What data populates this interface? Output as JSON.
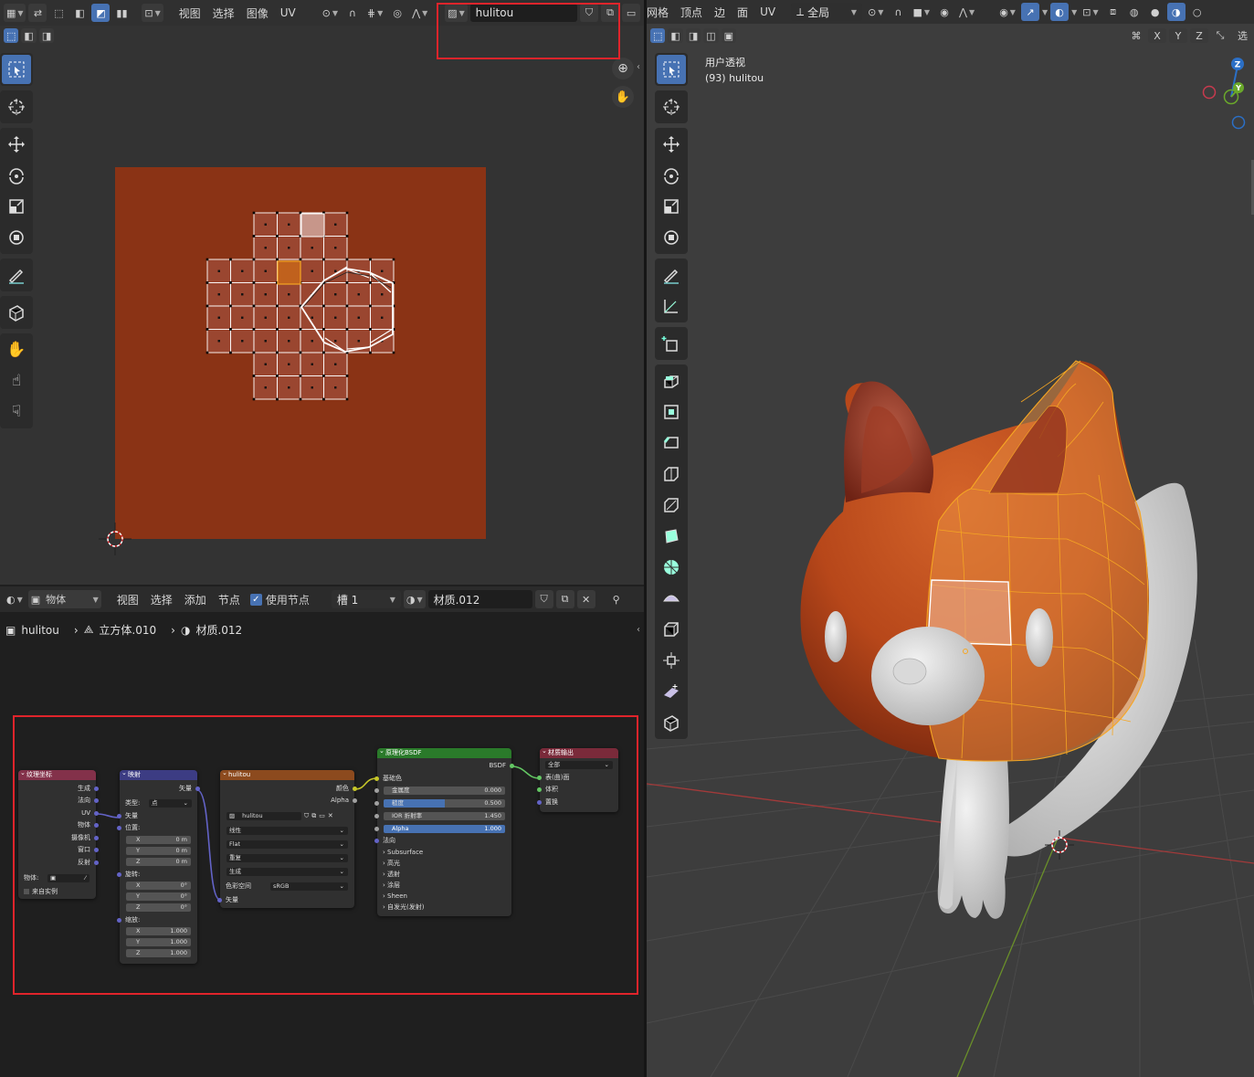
{
  "uv_editor": {
    "header": {
      "menus": [
        "视图",
        "选择",
        "图像",
        "UV"
      ],
      "image_name": "hulitou"
    }
  },
  "node_editor": {
    "header": {
      "mode": "物体",
      "menus": [
        "视图",
        "选择",
        "添加",
        "节点"
      ],
      "use_nodes_label": "使用节点",
      "use_nodes_checked": true,
      "slot": "槽 1",
      "material": "材质.012"
    },
    "breadcrumb": {
      "object": "hulitou",
      "mesh": "立方体.010",
      "material": "材质.012"
    },
    "nodes": {
      "texcoord": {
        "title": "纹理坐标",
        "outputs": [
          "生成",
          "法向",
          "UV",
          "物体",
          "摄像机",
          "窗口",
          "反射"
        ],
        "object_label": "物体:",
        "from_instancer": "来自实例"
      },
      "mapping": {
        "title": "映射",
        "output": "矢量",
        "type_label": "类型:",
        "type_value": "点",
        "vector_label": "矢量",
        "location_label": "位置:",
        "location": [
          [
            "X",
            "0 m"
          ],
          [
            "Y",
            "0 m"
          ],
          [
            "Z",
            "0 m"
          ]
        ],
        "rotation_label": "旋转:",
        "rotation": [
          [
            "X",
            "0°"
          ],
          [
            "Y",
            "0°"
          ],
          [
            "Z",
            "0°"
          ]
        ],
        "scale_label": "缩放:",
        "scale": [
          [
            "X",
            "1.000"
          ],
          [
            "Y",
            "1.000"
          ],
          [
            "Z",
            "1.000"
          ]
        ]
      },
      "image": {
        "title": "hulitou",
        "outputs": [
          "颜色",
          "Alpha"
        ],
        "image_name": "hulitou",
        "interpolation": "线性",
        "projection": "Flat",
        "extension": "重复",
        "source": "生成",
        "colorspace_label": "色彩空间",
        "colorspace": "sRGB",
        "vector_input": "矢量"
      },
      "bsdf": {
        "title": "原理化BSDF",
        "output": "BSDF",
        "base_color": "基础色",
        "metallic": [
          "金属度",
          "0.000"
        ],
        "roughness": [
          "糙度",
          "0.500",
          0.5
        ],
        "ior": [
          "IOR 折射率",
          "1.450"
        ],
        "alpha": [
          "Alpha",
          "1.000",
          1.0
        ],
        "normal": "法向",
        "panels": [
          "Subsurface",
          "高光",
          "透射",
          "涂层",
          "Sheen",
          "自发光(发射)"
        ]
      },
      "output": {
        "title": "材质输出",
        "target": "全部",
        "inputs": [
          "表(曲)面",
          "体积",
          "置换"
        ]
      }
    }
  },
  "viewport": {
    "header": {
      "menus": [
        "网格",
        "顶点",
        "边",
        "面",
        "UV"
      ],
      "transform_orientation": "全局"
    },
    "sub": {
      "axes": [
        "X",
        "Y",
        "Z"
      ],
      "more_label": "选"
    },
    "overlay": {
      "view_name": "用户透视",
      "object_info": "(93) hulitou"
    },
    "gizmo": {
      "z": "Z",
      "y": "Y"
    }
  },
  "colors": {
    "texture": "#8a3315",
    "accent": "#4772b3",
    "highlight": "#e0242b",
    "selection": "#f5a623",
    "node_input": "#83314a",
    "node_vector": "#3c3c83",
    "node_texture": "#8c4a1e",
    "node_shader": "#2a7a2a",
    "node_output": "#7a2a3a"
  }
}
